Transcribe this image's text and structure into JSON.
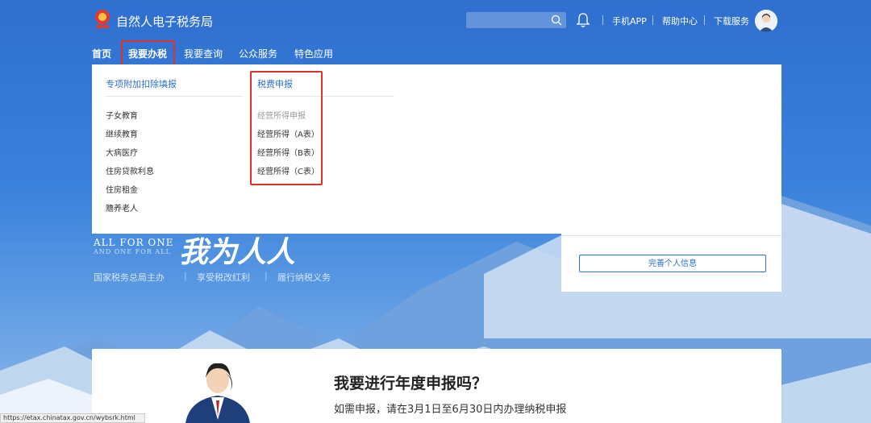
{
  "header": {
    "title": "自然人电子税务局",
    "links": [
      "手机APP",
      "帮助中心",
      "下载服务"
    ],
    "search_placeholder": ""
  },
  "nav": {
    "items": [
      "首页",
      "我要办税",
      "我要查询",
      "公众服务",
      "特色应用"
    ]
  },
  "dropdown": {
    "col1": {
      "title": "专项附加扣除填报",
      "items": [
        "子女教育",
        "继续教育",
        "大病医疗",
        "住房贷款利息",
        "住房租金",
        "赡养老人"
      ]
    },
    "col2": {
      "title": "税费申报",
      "items": [
        "经营所得申报",
        "经营所得（A表）",
        "经营所得（B表）",
        "经营所得（C表）"
      ]
    }
  },
  "hero": {
    "slogan_en1": "ALL FOR ONE",
    "slogan_en2": "AND ONE FOR ALL",
    "calligraphy": "我为人人",
    "taglines": [
      "国家税务总局主办",
      "享受税改红利",
      "履行纳税义务"
    ]
  },
  "profile_card": {
    "button": "完善个人信息"
  },
  "annual_card": {
    "question": "我要进行年度申报吗？",
    "hint": "如需申报，请在3月1日至6月30日内办理纳税申报"
  },
  "status_url": "https://etax.chinatax.gov.cn/wybsrk.html",
  "colors": {
    "brand_blue": "#2c6fd1",
    "highlight_red": "#e0312b"
  }
}
